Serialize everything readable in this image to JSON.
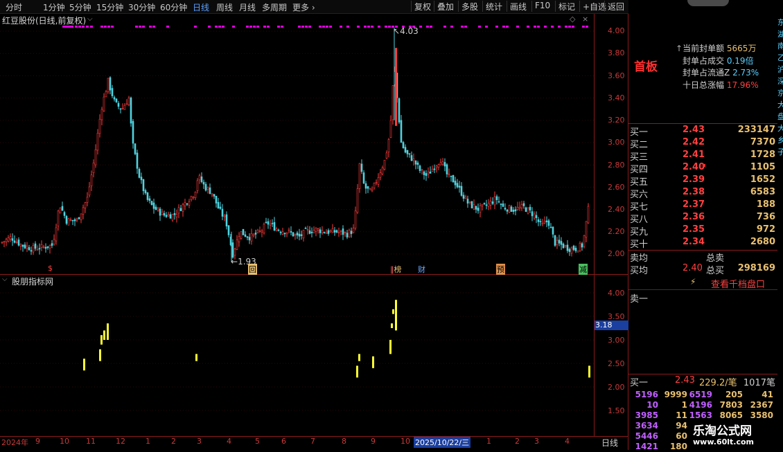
{
  "toolbar": {
    "periods": [
      "分时",
      "1分钟",
      "5分钟",
      "15分钟",
      "30分钟",
      "60分钟",
      "日线",
      "周线",
      "月线",
      "多周期",
      "更多"
    ],
    "active_period": "日线",
    "buttons": [
      "复权",
      "叠加",
      "多股",
      "统计",
      "画线",
      "F10",
      "标记",
      "+自选",
      "返回"
    ]
  },
  "main": {
    "title": "红豆股份(日线,前复权)",
    "y_ticks": [
      "4.00",
      "3.80",
      "3.60",
      "3.40",
      "3.20",
      "3.00",
      "2.80",
      "2.60",
      "2.40",
      "2.20",
      "2.00"
    ],
    "high_label": "4.03",
    "low_label": "1.93",
    "event_markers": [
      "$",
      "回",
      "榜",
      "财",
      "预",
      "减"
    ]
  },
  "sub": {
    "title": "股朋指标网",
    "y_ticks": [
      "4.00",
      "3.50",
      "3.00",
      "2.50",
      "2.00",
      "1.50"
    ],
    "current_value": "3.18"
  },
  "xaxis": {
    "labels": [
      "2024年",
      "9",
      "10",
      "11",
      "12",
      "1",
      "2",
      "3",
      "4",
      "5",
      "6",
      "7",
      "8",
      "9",
      "10",
      "2025/10/22/三",
      "1",
      "2",
      "3",
      "4"
    ],
    "period_label": "日线"
  },
  "right_panel": {
    "board_label": "首板",
    "stats": [
      {
        "label": "当前封单额",
        "value": "5665万"
      },
      {
        "label": "封单占成交",
        "value": "0.19倍"
      },
      {
        "label": "封单占流通Z",
        "value": "2.73%"
      },
      {
        "label": "十日总涨幅",
        "value": "17.96%"
      }
    ],
    "bids": [
      {
        "label": "买一",
        "price": "2.43",
        "vol": "233147"
      },
      {
        "label": "买二",
        "price": "2.42",
        "vol": "7370"
      },
      {
        "label": "买三",
        "price": "2.41",
        "vol": "1728"
      },
      {
        "label": "买四",
        "price": "2.40",
        "vol": "1105"
      },
      {
        "label": "买五",
        "price": "2.39",
        "vol": "1652"
      },
      {
        "label": "买六",
        "price": "2.38",
        "vol": "6583"
      },
      {
        "label": "买七",
        "price": "2.37",
        "vol": "188"
      },
      {
        "label": "买八",
        "price": "2.36",
        "vol": "736"
      },
      {
        "label": "买九",
        "price": "2.35",
        "vol": "972"
      },
      {
        "label": "买十",
        "price": "2.34",
        "vol": "2680"
      }
    ],
    "sell_avg_label": "卖均",
    "sell_total_label": "总卖",
    "buy_avg_label": "买均",
    "buy_avg_price": "2.40",
    "buy_total_label": "总买",
    "buy_total_vol": "298169",
    "view_depth_link": "查看千档盘口",
    "sell_one_label": "卖一",
    "buy_one_row": {
      "label": "买一",
      "price": "2.43",
      "per": "229.2/笔",
      "count": "1017笔"
    },
    "queue_rows": [
      [
        "5196",
        "9999",
        "6519",
        "205",
        "41"
      ],
      [
        "10",
        "1",
        "4196",
        "7803",
        "2367"
      ],
      [
        "3985",
        "11",
        "1563",
        "8065",
        "3580"
      ],
      [
        "3634",
        "94",
        "",
        "",
        ""
      ],
      [
        "5446",
        "60",
        "",
        "",
        ""
      ],
      [
        "1421",
        "180",
        "",
        "",
        ""
      ]
    ],
    "side_text": "东湖南乙沪深京大盘大乡子"
  },
  "watermark": {
    "title": "乐淘公式网",
    "url": "www.60lt.com"
  },
  "colors": {
    "up": "#ff3a3a",
    "down": "#4fd4e0",
    "indicator": "#ffff33",
    "accent_blue": "#5aa0ff",
    "grid_red": "#8b1a1a"
  }
}
